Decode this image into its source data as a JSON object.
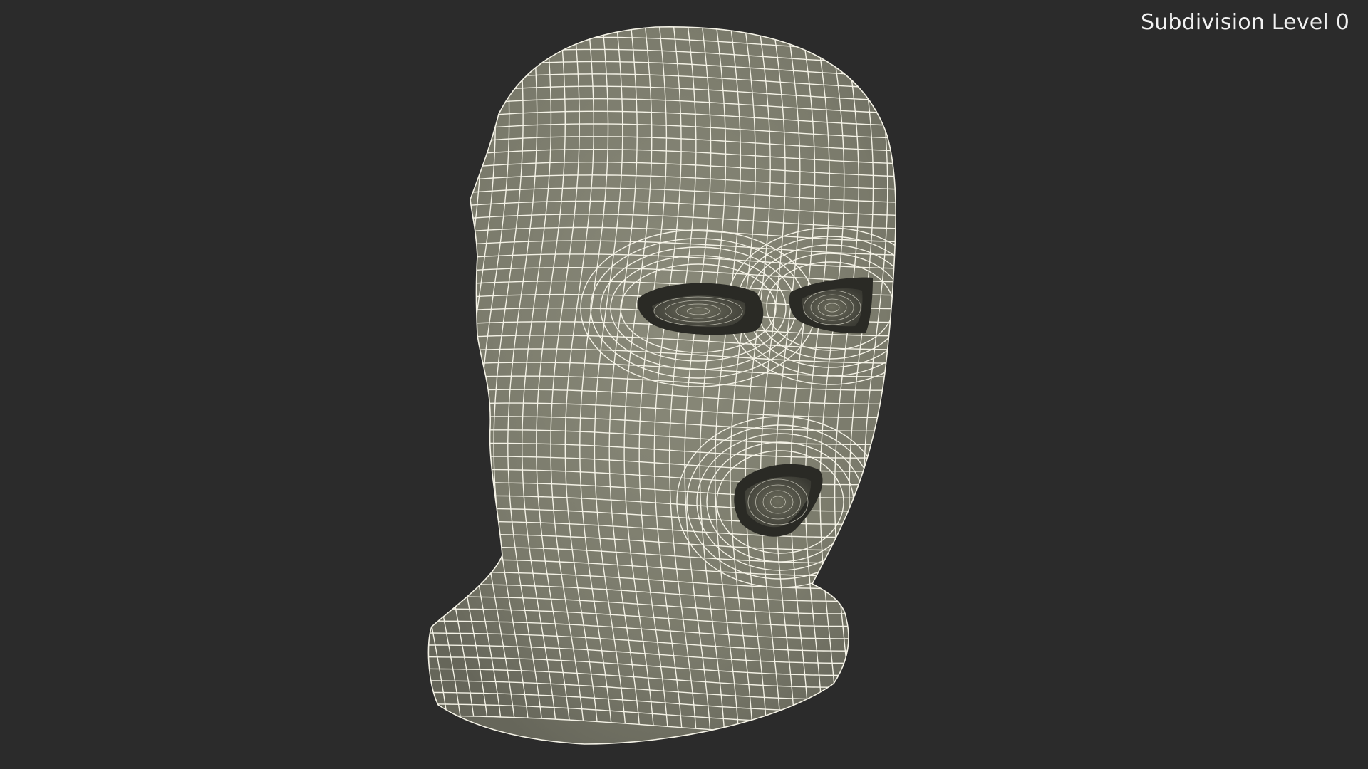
{
  "viewport": {
    "overlay_label": "Subdivision Level 0",
    "background_color": "#2b2b2b"
  },
  "model": {
    "name": "balaclava-wireframe",
    "surface_color": "#7b7b6c",
    "wire_color": "#f4f2e6",
    "hole_color": "#2a2a25",
    "hole_fill_color": "#5a5a4c"
  }
}
